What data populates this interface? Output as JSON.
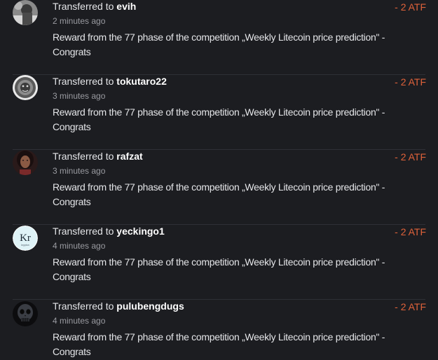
{
  "colors": {
    "background": "#1c1d21",
    "divider": "#2e3036",
    "text": "#e4e5e8",
    "muted": "#9a9ba1",
    "amount": "#e0623a"
  },
  "transactions": [
    {
      "prefix": "Transferred to",
      "recipient": "evih",
      "time": "2 minutes ago",
      "memo": "Reward from the 77 phase of the competition „Weekly Litecoin price prediction\" - Congrats",
      "amount": "- 2 ATF",
      "avatar_icon": "user-photo-icon"
    },
    {
      "prefix": "Transferred to",
      "recipient": "tokutaro22",
      "time": "3 minutes ago",
      "memo": "Reward from the 77 phase of the competition „Weekly Litecoin price prediction\" - Congrats",
      "amount": "- 2 ATF",
      "avatar_icon": "lion-emblem-icon"
    },
    {
      "prefix": "Transferred to",
      "recipient": "rafzat",
      "time": "3 minutes ago",
      "memo": "Reward from the 77 phase of the competition „Weekly Litecoin price prediction\" - Congrats",
      "amount": "- 2 ATF",
      "avatar_icon": "user-photo-icon"
    },
    {
      "prefix": "Transferred to",
      "recipient": "yeckingo1",
      "time": "4 minutes ago",
      "memo": "Reward from the 77 phase of the competition „Weekly Litecoin price prediction\" - Congrats",
      "amount": "- 2 ATF",
      "avatar_icon": "krypton-element-icon",
      "avatar_text": "Kr",
      "avatar_subtext": "krypton"
    },
    {
      "prefix": "Transferred to",
      "recipient": "pulubengdugs",
      "time": "4 minutes ago",
      "memo": "Reward from the 77 phase of the competition „Weekly Litecoin price prediction\" - Congrats",
      "amount": "- 2 ATF",
      "avatar_icon": "skull-icon"
    }
  ]
}
